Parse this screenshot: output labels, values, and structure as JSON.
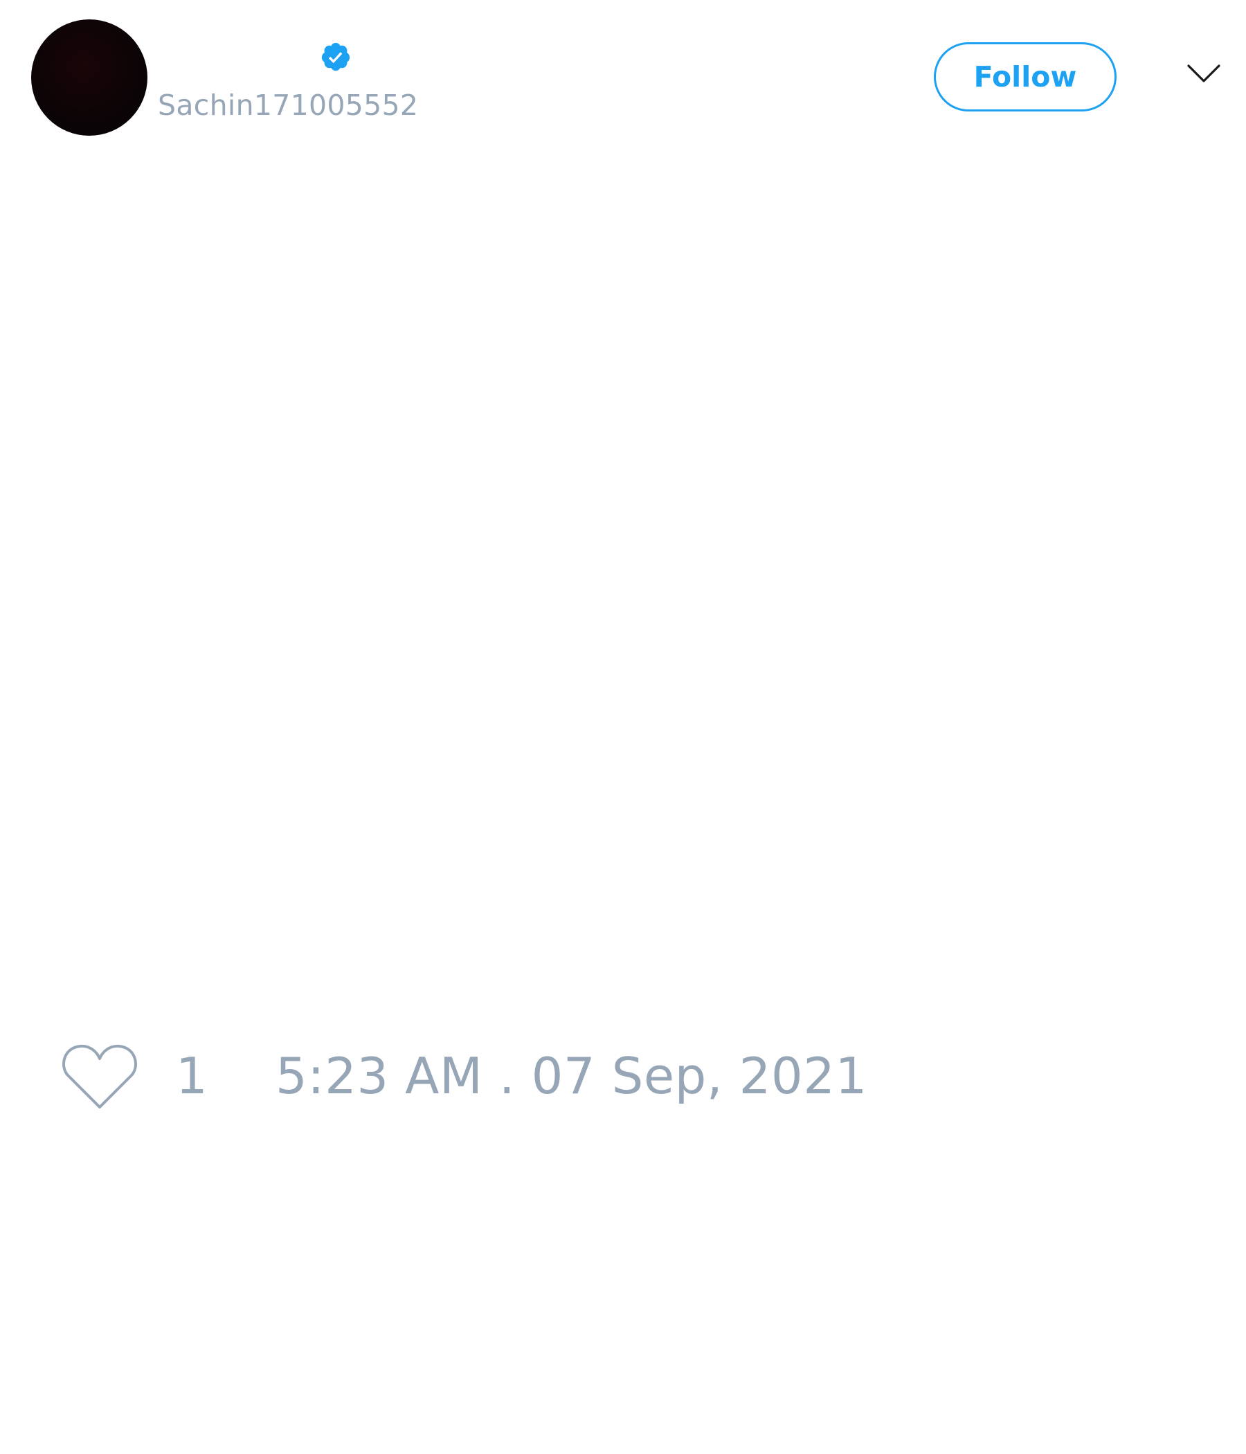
{
  "tweet": {
    "author": {
      "avatar_icon": "avatar-image",
      "verified_icon": "verified-badge-icon",
      "handle": "Sachin171005552"
    },
    "follow_label": "Follow",
    "menu_icon": "chevron-down-icon",
    "likes": {
      "icon": "heart-icon",
      "count": "1"
    },
    "timestamp": "5:23 AM . 07 Sep, 2021"
  },
  "colors": {
    "accent": "#1da1f2",
    "muted_text": "#97a6b7",
    "avatar": "#0b0406",
    "background": "#ffffff"
  }
}
